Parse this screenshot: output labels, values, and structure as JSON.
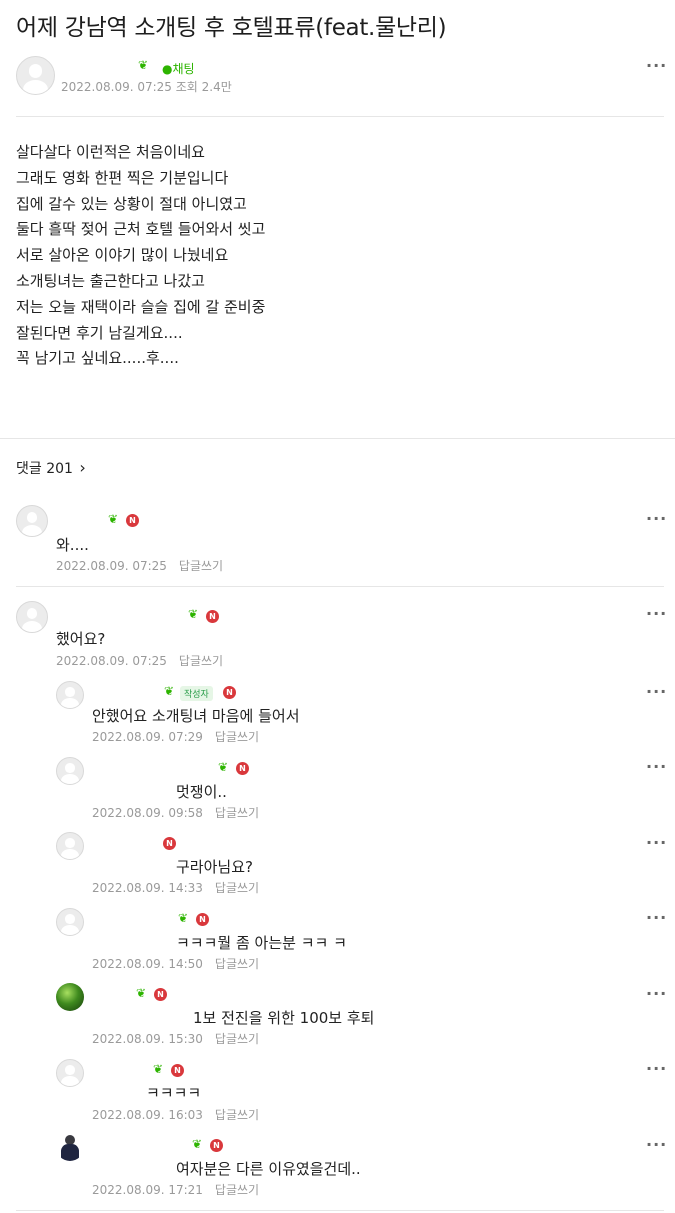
{
  "post": {
    "title": "어제 강남역 소개팅 후 호텔표류(feat.물난리)",
    "chat_label": "채팅",
    "meta": "2022.08.09. 07:25 조회 2.4만",
    "body": "살다살다 이런적은 처음이네요\n그래도 영화 한편 찍은 기분입니다\n집에 갈수 있는 상황이 절대 아니였고\n둘다 흘딱 젖어 근처 호텔 들어와서 씻고\n서로 살아온 이야기 많이 나눴네요\n소개팅녀는 출근한다고 나갔고\n저는 오늘 재택이라 슬슬 집에 갈 준비중\n잘된다면 후기 남길게요....\n꼭 남기고 싶네요.....후...."
  },
  "comments_header": {
    "label": "댓글 201",
    "chevron": "›"
  },
  "comments": [
    {
      "text": "와....",
      "date": "2022.08.09. 07:25",
      "reply": "답글쓰기"
    },
    {
      "text": "했어요?",
      "date": "2022.08.09. 07:25",
      "reply": "답글쓰기"
    }
  ],
  "replies": [
    {
      "text": "안했어요 소개팅녀 마음에 들어서",
      "date": "2022.08.09. 07:29",
      "reply": "답글쓰기",
      "tag": "작성자"
    },
    {
      "text": "멋쟁이..",
      "date": "2022.08.09. 09:58",
      "reply": "답글쓰기"
    },
    {
      "text": "구라아님요?",
      "date": "2022.08.09. 14:33",
      "reply": "답글쓰기"
    },
    {
      "text": "ㅋㅋㅋ뭘 좀 아는분 ㅋㅋ ㅋ",
      "date": "2022.08.09. 14:50",
      "reply": "답글쓰기"
    },
    {
      "text": "1보 전진을 위한 100보 후퇴",
      "date": "2022.08.09. 15:30",
      "reply": "답글쓰기"
    },
    {
      "text": "ㅋㅋㅋㅋ",
      "date": "2022.08.09. 16:03",
      "reply": "답글쓰기"
    },
    {
      "text": "여자분은 다른 이유였을건데..",
      "date": "2022.08.09. 17:21",
      "reply": "답글쓰기"
    }
  ],
  "icons": {
    "sprout": "sprout-icon",
    "new_badge": "N",
    "more": "more-dots-icon",
    "chat": "chat-bubble-icon"
  },
  "colors": {
    "accent_green": "#2db400",
    "new_badge_red": "#d9383c",
    "meta_gray": "#9a9a9a"
  }
}
